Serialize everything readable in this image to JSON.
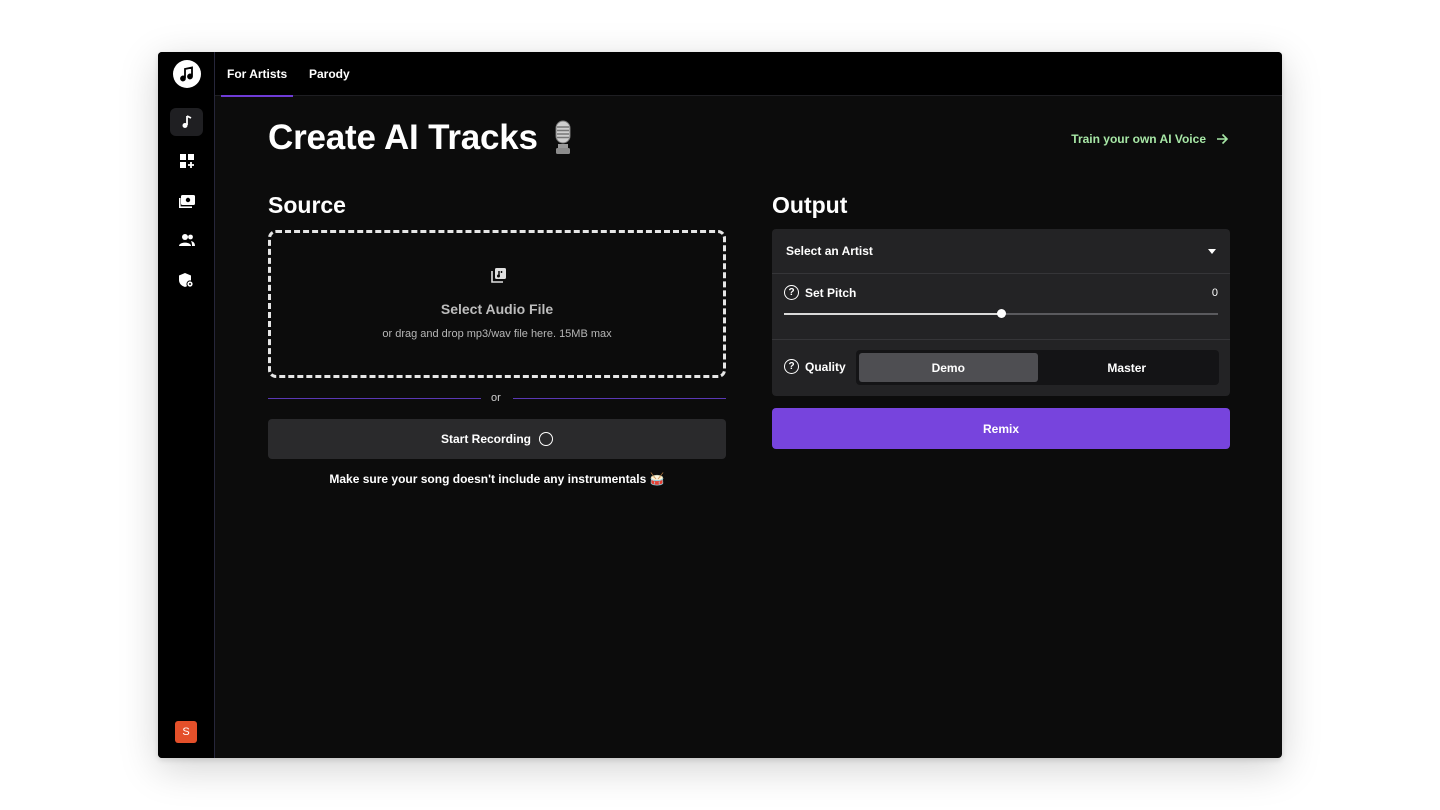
{
  "colors": {
    "accent": "#7744dd",
    "link_green": "#a7e7a6",
    "avatar_bg": "#e4502a"
  },
  "sidebar": {
    "logo": "music-note-icon",
    "items": [
      {
        "icon": "music-note-icon",
        "active": true
      },
      {
        "icon": "dashboard-add-icon",
        "active": false
      },
      {
        "icon": "media-library-icon",
        "active": false
      },
      {
        "icon": "users-icon",
        "active": false
      },
      {
        "icon": "shield-settings-icon",
        "active": false
      }
    ],
    "avatar_letter": "S"
  },
  "topbar": {
    "tabs": [
      {
        "label": "For Artists",
        "active": true
      },
      {
        "label": "Parody",
        "active": false
      }
    ]
  },
  "header": {
    "title": "Create AI Tracks",
    "title_icon": "microphone-icon",
    "train_link": "Train your own AI Voice"
  },
  "source": {
    "heading": "Source",
    "dropzone_title": "Select Audio File",
    "dropzone_subtitle": "or drag and drop mp3/wav file here. 15MB max",
    "or_text": "or",
    "record_button": "Start Recording",
    "note": "Make sure your song doesn't include any instrumentals 🥁"
  },
  "output": {
    "heading": "Output",
    "artist_placeholder": "Select an Artist",
    "pitch_label": "Set Pitch",
    "pitch_value": "0",
    "pitch_fraction": 0.5,
    "quality_label": "Quality",
    "quality_options": [
      "Demo",
      "Master"
    ],
    "quality_selected": "Demo",
    "remix_button": "Remix"
  }
}
